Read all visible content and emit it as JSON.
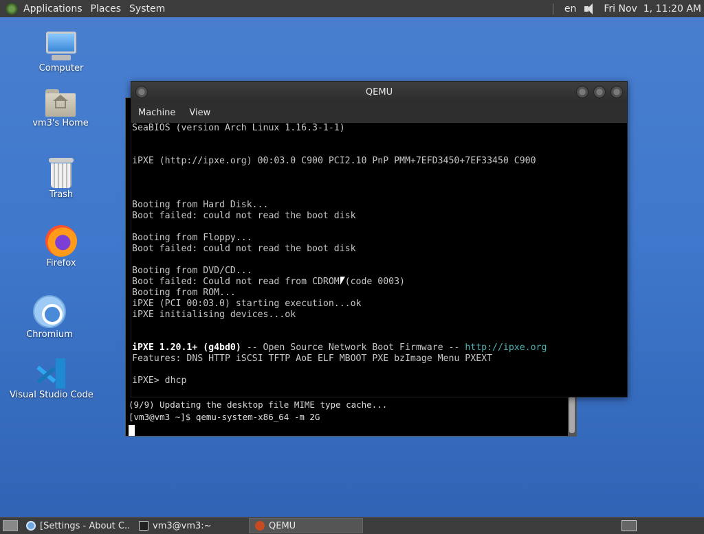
{
  "top_panel": {
    "menus": [
      "Applications",
      "Places",
      "System"
    ],
    "keyboard_layout": "en",
    "clock": "Fri Nov  1, 11:20 AM"
  },
  "desktop_icons": [
    {
      "label": "Computer",
      "icon": "computer-icon"
    },
    {
      "label": "vm3's Home",
      "icon": "home-folder-icon"
    },
    {
      "label": "Trash",
      "icon": "trash-icon"
    },
    {
      "label": "Firefox",
      "icon": "firefox-icon"
    },
    {
      "label": "Chromium",
      "icon": "chromium-icon"
    },
    {
      "label": "Visual Studio Code",
      "icon": "vscode-icon"
    }
  ],
  "terminal": {
    "lines": [
      "(9/9) Updating the desktop file MIME type cache...",
      "[vm3@vm3 ~]$ qemu-system-x86_64 -m 2G"
    ]
  },
  "qemu": {
    "title": "QEMU",
    "menu": [
      "Machine",
      "View"
    ],
    "boot": {
      "l01": "SeaBIOS (version Arch Linux 1.16.3-1-1)",
      "l02": "",
      "l03": "",
      "l04": "iPXE (http://ipxe.org) 00:03.0 C900 PCI2.10 PnP PMM+7EFD3450+7EF33450 C900",
      "l05": "",
      "l06": "",
      "l07": "",
      "l08": "Booting from Hard Disk...",
      "l09": "Boot failed: could not read the boot disk",
      "l10": "",
      "l11": "Booting from Floppy...",
      "l12": "Boot failed: could not read the boot disk",
      "l13": "",
      "l14": "Booting from DVD/CD...",
      "l15": "Boot failed: Could not read from CDROM (code 0003)",
      "l16": "Booting from ROM...",
      "l17": "iPXE (PCI 00:03.0) starting execution...ok",
      "l18": "iPXE initialising devices...ok",
      "l19": "",
      "l20": "",
      "l21_main": "iPXE 1.20.1+ (g4bd0)",
      "l21_rest": " -- Open Source Network Boot Firmware -- ",
      "l21_link": "http://ipxe.org",
      "l22": "Features: DNS HTTP iSCSI TFTP AoE ELF MBOOT PXE bzImage Menu PXEXT",
      "l23": "",
      "l24": "iPXE> dhcp"
    }
  },
  "taskbar": {
    "items": [
      {
        "label": "[Settings - About C...",
        "icon": "chromium-icon",
        "active": false
      },
      {
        "label": "vm3@vm3:~",
        "icon": "terminal-icon",
        "active": false
      },
      {
        "label": "QEMU",
        "icon": "qemu-icon",
        "active": true
      }
    ]
  }
}
